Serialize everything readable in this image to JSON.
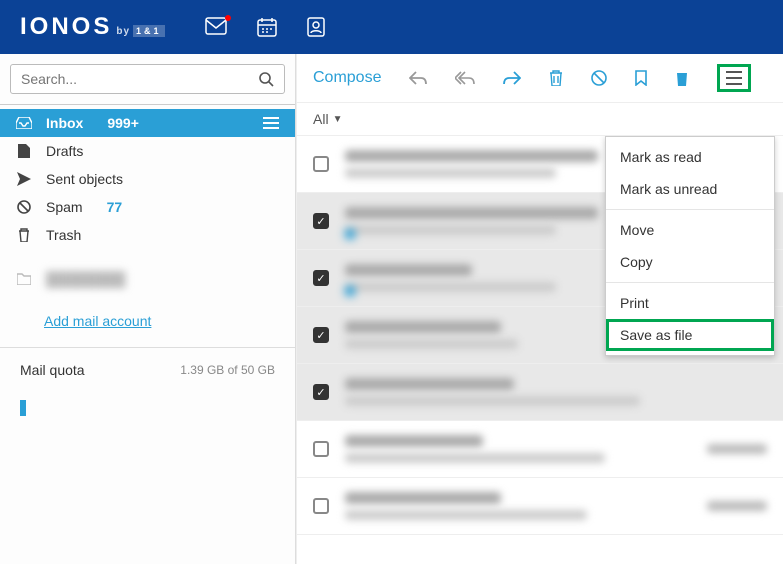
{
  "header": {
    "logo_main": "IONOS",
    "logo_sub": "by",
    "logo_badge": "1&1"
  },
  "search": {
    "placeholder": "Search..."
  },
  "folders": {
    "inbox": {
      "label": "Inbox",
      "count": "999+"
    },
    "drafts": {
      "label": "Drafts"
    },
    "sent": {
      "label": "Sent objects"
    },
    "spam": {
      "label": "Spam",
      "count": "77"
    },
    "trash": {
      "label": "Trash"
    }
  },
  "add_account": "Add mail account",
  "quota": {
    "label": "Mail quota",
    "text": "1.39 GB of 50 GB"
  },
  "toolbar": {
    "compose": "Compose"
  },
  "listbar": {
    "filter": "All"
  },
  "menu": {
    "mark_read": "Mark as read",
    "mark_unread": "Mark as unread",
    "move": "Move",
    "copy": "Copy",
    "print": "Print",
    "save_file": "Save as file"
  }
}
